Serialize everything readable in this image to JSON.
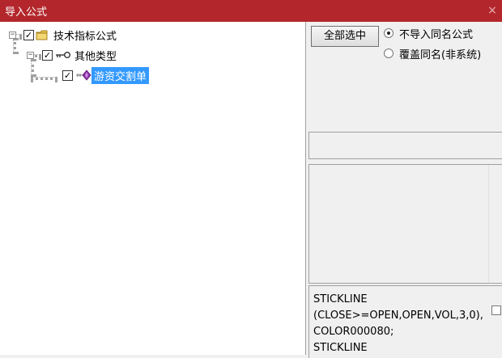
{
  "window": {
    "title": "导入公式",
    "close_glyph": "×"
  },
  "tree": {
    "root": {
      "label": "技术指标公式",
      "expander": "−",
      "checked": true,
      "icon": "folder-icon"
    },
    "child": {
      "label": "其他类型",
      "expander": "−",
      "checked": true,
      "icon": "key-icon"
    },
    "leaf": {
      "label": "游资交割单",
      "checked": true,
      "selected": true,
      "icon": "formula-diamond-icon"
    },
    "check_glyph": "✓"
  },
  "panel": {
    "select_all_button": "全部选中",
    "radio_options": [
      {
        "label": "不导入同名公式",
        "selected": true
      },
      {
        "label": "覆盖同名(非系统)",
        "selected": false
      }
    ],
    "name_field_value": "",
    "description_value": "",
    "code_text": "STICKLINE\n(CLOSE>=OPEN,OPEN,VOL,3,0),COLOR000080;\nSTICKLINE",
    "code_checkbox_checked": false
  },
  "colors": {
    "titlebar": "#b3272c",
    "selection": "#3399ff",
    "folder": "#e8c14a",
    "diamond": "#8e2fa8"
  }
}
